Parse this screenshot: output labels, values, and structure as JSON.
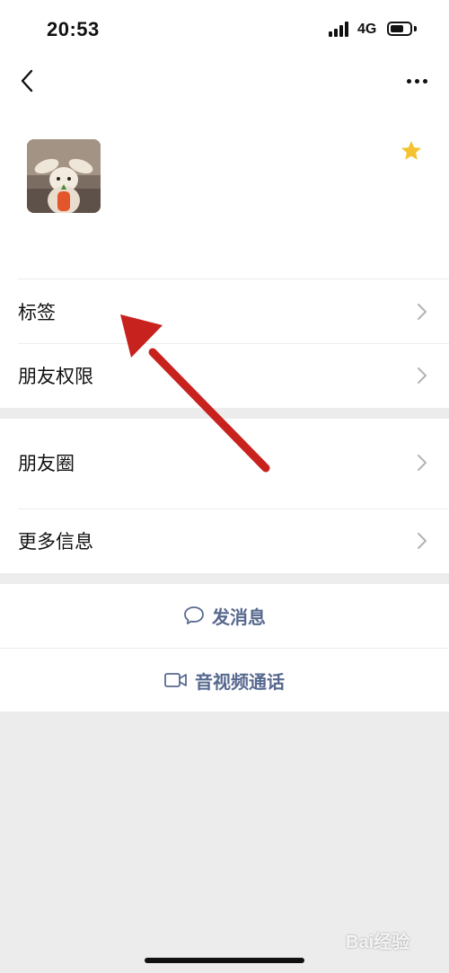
{
  "status_bar": {
    "time": "20:53",
    "network": "4G"
  },
  "nav": {
    "back_icon": "chevron-left-icon",
    "more_icon": "ellipsis-icon"
  },
  "profile": {
    "avatar_icon": "plush-bunny-avatar",
    "star_icon": "star-icon",
    "star_color": "#f5c332"
  },
  "rows": [
    {
      "label": "标签"
    },
    {
      "label": "朋友权限"
    },
    {
      "label": "朋友圈"
    },
    {
      "label": "更多信息"
    }
  ],
  "actions": {
    "message": {
      "label": "发消息",
      "icon": "chat-bubble-icon"
    },
    "call": {
      "label": "音视频通话",
      "icon": "video-camera-icon"
    }
  },
  "colors": {
    "accent": "#57698f",
    "background": "#ececec",
    "annotation": "#c8221e"
  },
  "watermark": "Bai经验"
}
